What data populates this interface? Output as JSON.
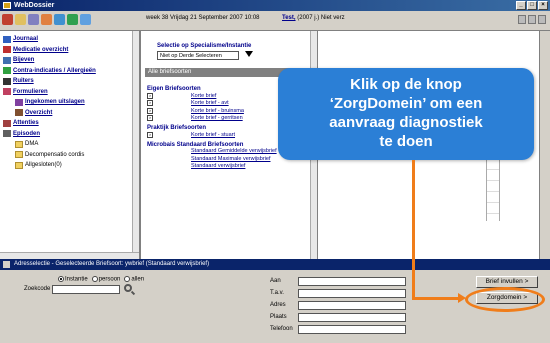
{
  "window": {
    "title": "WebDossier",
    "buttons": [
      "_",
      "□",
      "×"
    ]
  },
  "toolbar": {
    "date_info": "week 38 Vrijdag 21 September 2007 10:08",
    "patient_name": "Test,",
    "patient_info": "(2007 j.) Niet verz",
    "icons": [
      "home-icon",
      "mail-icon",
      "tools-icon",
      "user-icon",
      "search-icon",
      "globe-icon",
      "flag-icon"
    ]
  },
  "nav": {
    "items": [
      {
        "label": "Journaal",
        "icon": "journal-icon",
        "type": "top"
      },
      {
        "label": "Medicatie overzicht",
        "icon": "medication-icon",
        "type": "top"
      },
      {
        "label": "Bijeven",
        "icon": "sheet-icon",
        "type": "top"
      },
      {
        "label": "Contra-indicaties / Allergieën",
        "icon": "warning-icon",
        "type": "top"
      },
      {
        "label": "Ruiters",
        "icon": "rider-icon",
        "type": "top"
      },
      {
        "label": "Formulieren",
        "icon": "form-icon",
        "type": "top"
      },
      {
        "label": "Ingekomen uitslagen",
        "icon": "inbox-icon",
        "type": "sub"
      },
      {
        "label": "Overzicht",
        "icon": "overview-icon",
        "type": "sub"
      },
      {
        "label": "Attenties",
        "icon": "attention-icon",
        "type": "top"
      },
      {
        "label": "Episoden",
        "icon": "episode-icon",
        "type": "top"
      },
      {
        "label": "DMA",
        "icon": "folder-icon",
        "type": "folder"
      },
      {
        "label": "Decompensatio cordis",
        "icon": "folder-icon",
        "type": "folder"
      },
      {
        "label": "Allgesloten(0)",
        "icon": "folder-icon",
        "type": "folder"
      }
    ]
  },
  "letters": {
    "selection_label": "Selectie op Specialisme/Instantie",
    "selection_value": "Niet op Derde Selecteren",
    "all_header": "Alle briefsoorten",
    "groups": [
      {
        "title": "Eigen Briefsoorten",
        "rows": [
          {
            "label": "Korte brief",
            "box": true
          },
          {
            "label": "Korte brief - avt",
            "box": true
          },
          {
            "label": "Korte brief - bruinsma",
            "box": true
          },
          {
            "label": "Korte brief - gerritsen",
            "box": true
          }
        ]
      },
      {
        "title": "Praktijk Briefsoorten",
        "rows": [
          {
            "label": "Korte brief - stuart",
            "box": true
          }
        ]
      },
      {
        "title": "Microbais Standaard Briefsoorten",
        "rows": [
          {
            "label": "Standaard Gemiddelde verwijsbrief",
            "box": false
          },
          {
            "label": "Standaard Maximale verwijsbrief",
            "box": false
          },
          {
            "label": "Standaard verwijsbrief",
            "box": false
          }
        ]
      }
    ]
  },
  "status_bar": {
    "text": "Adresselectie - Geselecteerde Briefsoort: ywbrief (Standaard verwijsbrief)"
  },
  "search": {
    "radio_options": [
      {
        "label": "Instantie",
        "selected": true
      },
      {
        "label": "persoon",
        "selected": false
      },
      {
        "label": "allen",
        "selected": false
      }
    ],
    "label": "Zoekcode",
    "value": ""
  },
  "address": {
    "fields": [
      {
        "label": "Aan",
        "value": ""
      },
      {
        "label": "T.a.v.",
        "value": ""
      },
      {
        "label": "Adres",
        "value": ""
      },
      {
        "label": "Plaats",
        "value": ""
      },
      {
        "label": "Telefoon",
        "value": ""
      }
    ]
  },
  "buttons": {
    "mail": "Brief invullen >",
    "zorgdomein": "Zorgdomein >"
  },
  "callout": {
    "text": "Klik op de knop\n‘ZorgDomein’ om een\naanvraag diagnostiek\nte doen"
  },
  "colors": {
    "callout": "#2b7fd6",
    "arrow": "#f07d1a",
    "titlebar": "#0a246a"
  }
}
